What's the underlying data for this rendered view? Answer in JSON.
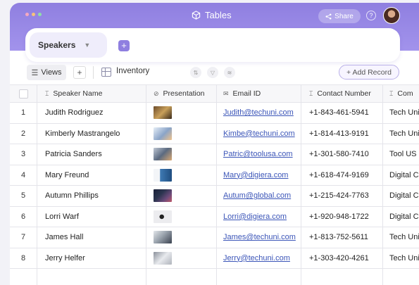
{
  "window": {
    "title": "Tables",
    "title_icon": "cube-icon",
    "dot_colors": [
      "#f4a9c0",
      "#f7c37a",
      "#8fe0a7"
    ]
  },
  "topbar": {
    "share_label": "Share",
    "help_label": "?"
  },
  "view_tab": {
    "label": "Speakers"
  },
  "toolbar": {
    "views_label": "Views",
    "add_label": "+",
    "table_name": "Inventory",
    "add_record_label": "+ Add Record"
  },
  "table": {
    "columns": [
      {
        "label": "Speaker Name",
        "icon": "text-field-icon",
        "icon_glyph": "⌶"
      },
      {
        "label": "Presentation",
        "icon": "attachment-icon",
        "icon_glyph": "⊘"
      },
      {
        "label": "Email ID",
        "icon": "email-icon",
        "icon_glyph": "✉"
      },
      {
        "label": "Contact Number",
        "icon": "text-field-icon",
        "icon_glyph": "⌶"
      },
      {
        "label": "Com",
        "icon": "text-field-icon",
        "icon_glyph": "⌶"
      }
    ],
    "rows": [
      {
        "num": "1",
        "name": "Judith Rodriguez",
        "email": "Judith@techuni.com",
        "phone": "+1-843-461-5941",
        "company": "Tech Uni",
        "thumb_color": "#c9a05a"
      },
      {
        "num": "2",
        "name": "Kimberly Mastrangelo",
        "email": "Kimbe@techuni.com",
        "phone": "+1-814-413-9191",
        "company": "Tech Uni",
        "thumb_color": "#8aa4c8"
      },
      {
        "num": "3",
        "name": "Patricia Sanders",
        "email": "Patric@toolusa.com",
        "phone": "+1-301-580-7410",
        "company": "Tool US",
        "thumb_color": "#5b6a80"
      },
      {
        "num": "4",
        "name": "Mary Freund",
        "email": "Mary@digiera.com",
        "phone": "+1-618-474-9169",
        "company": "Digital C",
        "thumb_color": "#3f7ab4"
      },
      {
        "num": "5",
        "name": "Autumn Phillips",
        "email": "Autum@global.com",
        "phone": "+1-215-424-7763",
        "company": "Digital C",
        "thumb_color": "#2c3550"
      },
      {
        "num": "6",
        "name": "Lorri Warf",
        "email": "Lorri@digiera.com",
        "phone": "+1-920-948-1722",
        "company": "Digital C",
        "thumb_color": "#d8d8dc"
      },
      {
        "num": "7",
        "name": "James Hall",
        "email": "James@techuni.com",
        "phone": "+1-813-752-5611",
        "company": "Tech Uni",
        "thumb_color": "#9aa3ad"
      },
      {
        "num": "8",
        "name": "Jerry Helfer",
        "email": "Jerry@techuni.com",
        "phone": "+1-303-420-4261",
        "company": "Tech Uni",
        "thumb_color": "#b0b4bc"
      }
    ]
  }
}
